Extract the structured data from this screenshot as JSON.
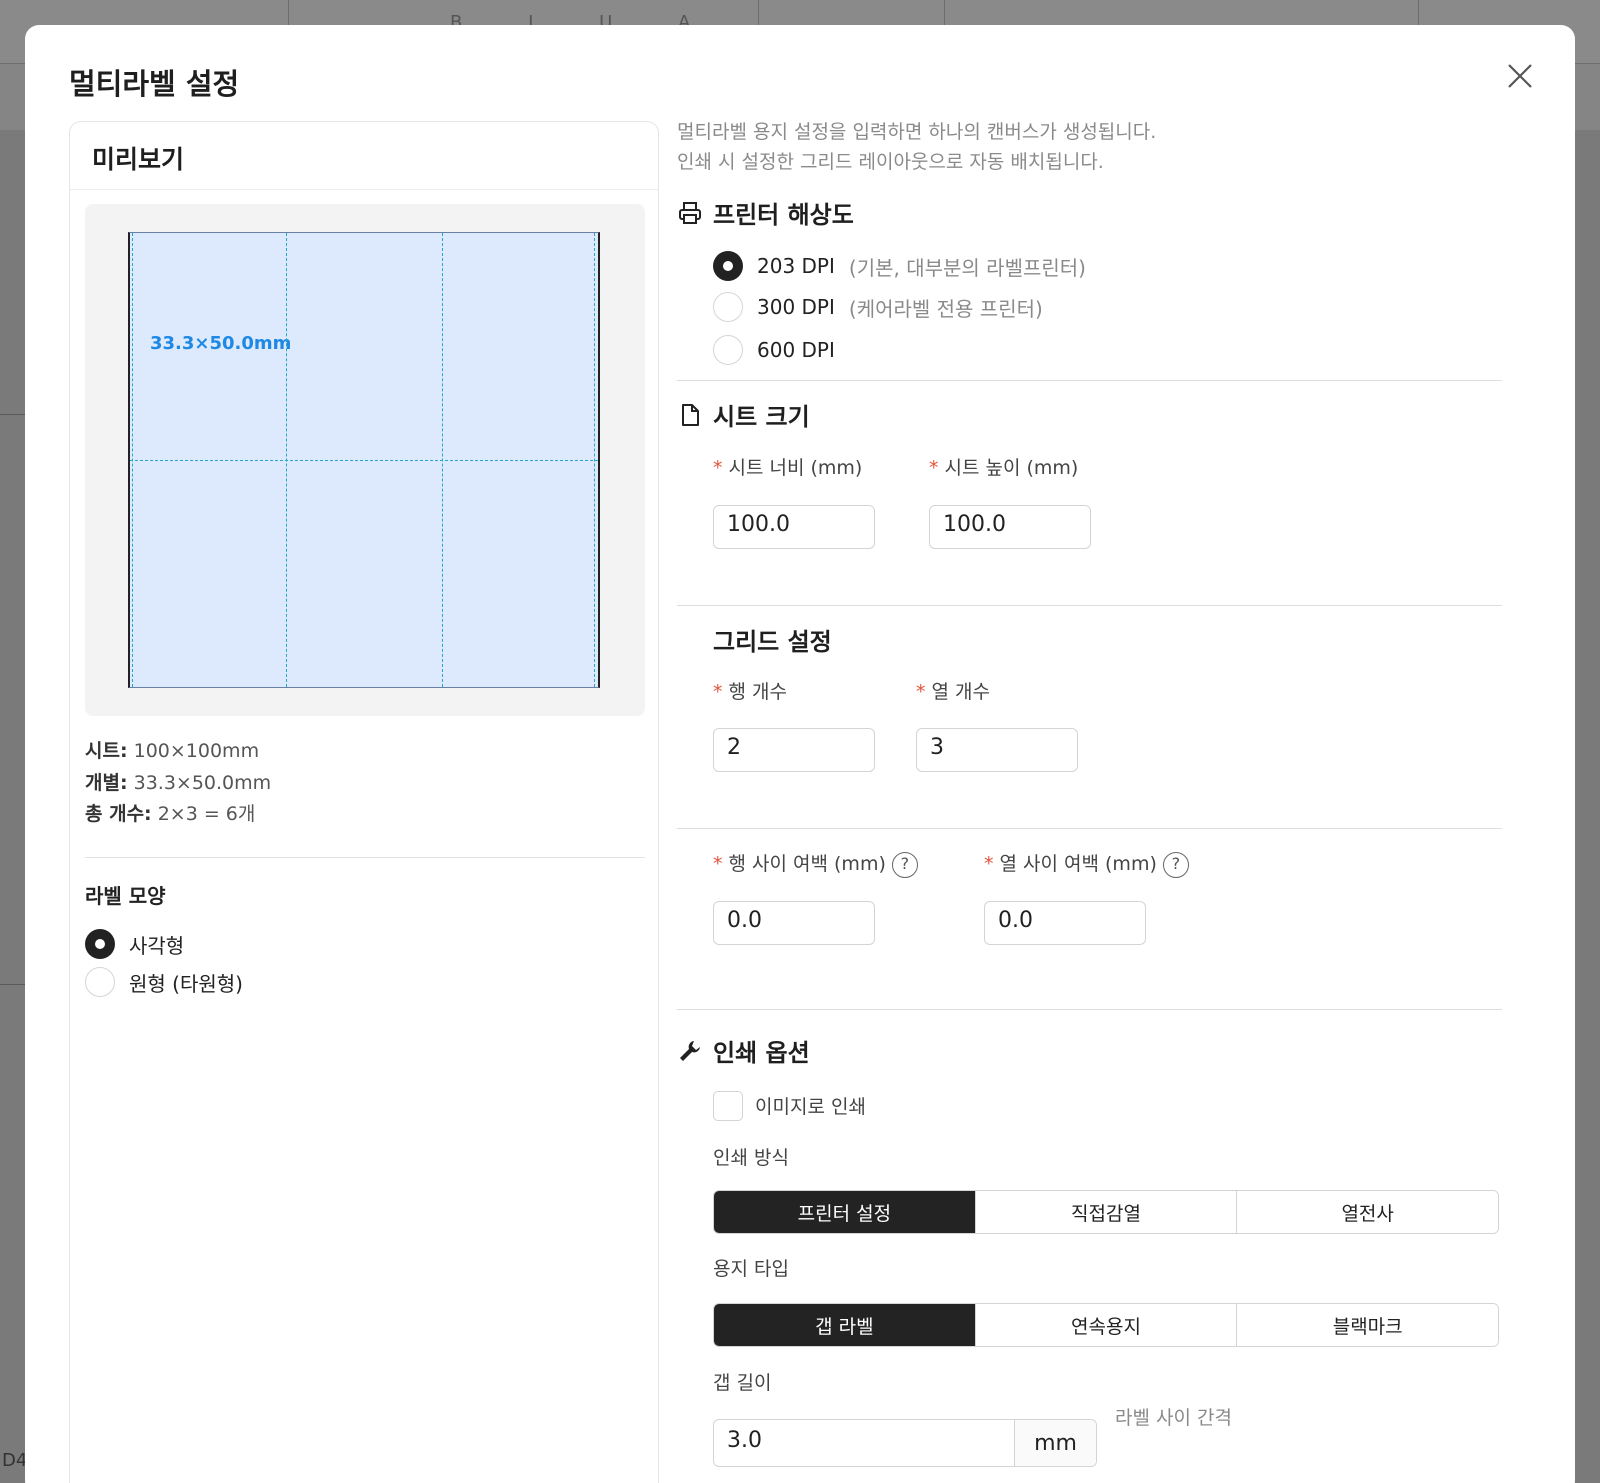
{
  "background": {
    "corner_text": "D4",
    "toolbar_glyphs": "B I U A"
  },
  "modal": {
    "title": "멀티라벨 설정",
    "preview": {
      "title": "미리보기",
      "cell_label": "33.3×50.0mm",
      "rows": 2,
      "cols": 3,
      "info": [
        {
          "key": "시트:",
          "value": "100×100mm"
        },
        {
          "key": "개별:",
          "value": "33.3×50.0mm"
        },
        {
          "key": "총 개수:",
          "value": "2×3 = 6개"
        }
      ],
      "shape_title": "라벨 모양",
      "shapes": [
        {
          "label": "사각형",
          "checked": true
        },
        {
          "label": "원형 (타원형)",
          "checked": false
        }
      ]
    },
    "description": [
      "멀티라벨 용지 설정을 입력하면 하나의 캔버스가 생성됩니다.",
      "인쇄 시 설정한 그리드 레이아웃으로 자동 배치됩니다."
    ],
    "printer_resolution": {
      "title": "프린터 해상도",
      "options": [
        {
          "label": "203 DPI",
          "hint": "(기본, 대부분의 라벨프린터)",
          "checked": true
        },
        {
          "label": "300 DPI",
          "hint": "(케어라벨 전용 프린터)",
          "checked": false
        },
        {
          "label": "600 DPI",
          "hint": "",
          "checked": false
        }
      ]
    },
    "sheet_size": {
      "title": "시트 크기",
      "width_label": "시트 너비 (mm)",
      "width_value": "100.0",
      "height_label": "시트 높이 (mm)",
      "height_value": "100.0"
    },
    "grid": {
      "title": "그리드 설정",
      "rows_label": "행 개수",
      "rows_value": "2",
      "cols_label": "열 개수",
      "cols_value": "3",
      "row_gap_label": "행 사이 여백 (mm)",
      "row_gap_value": "0.0",
      "col_gap_label": "열 사이 여백 (mm)",
      "col_gap_value": "0.0",
      "help_glyph": "?"
    },
    "print_options": {
      "title": "인쇄 옵션",
      "print_as_image_label": "이미지로 인쇄",
      "method_label": "인쇄 방식",
      "methods": [
        {
          "label": "프린터 설정",
          "active": true
        },
        {
          "label": "직접감열",
          "active": false
        },
        {
          "label": "열전사",
          "active": false
        }
      ],
      "paper_type_label": "용지 타입",
      "paper_types": [
        {
          "label": "갭 라벨",
          "active": true
        },
        {
          "label": "연속용지",
          "active": false
        },
        {
          "label": "블랙마크",
          "active": false
        }
      ],
      "gap_length_label": "갭 길이",
      "gap_length_value": "3.0",
      "gap_length_unit": "mm",
      "gap_length_hint": "라벨 사이 간격"
    },
    "colors": {
      "required": "#e5533c",
      "cell_fill": "#dde9fc",
      "cell_label": "#1e88e5",
      "active_segment": "#232323"
    }
  }
}
